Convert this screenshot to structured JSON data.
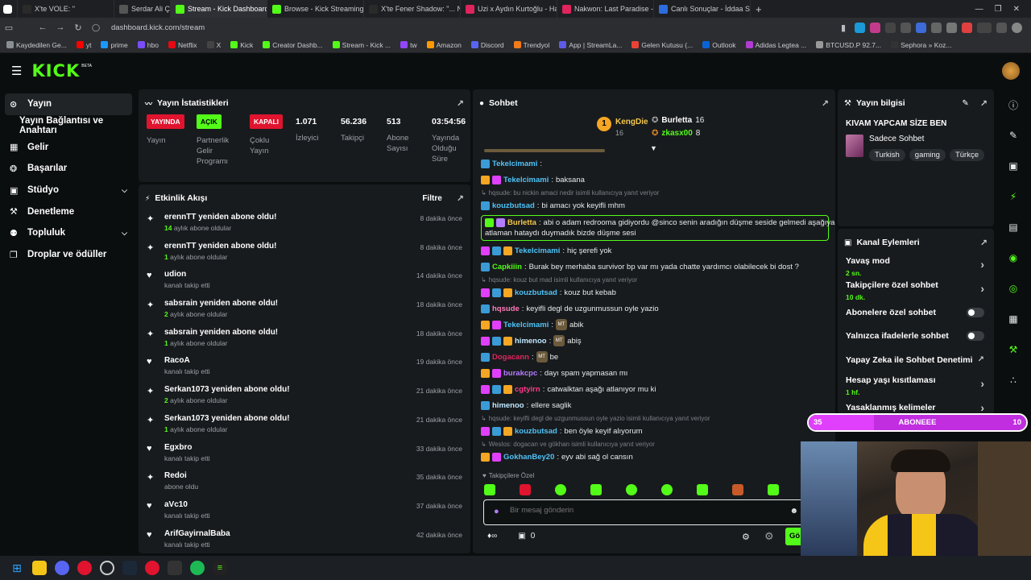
{
  "browser": {
    "tabs": [
      {
        "label": "X'te VOLE: \"",
        "color": "#2a2a2a"
      },
      {
        "label": "Serdar Ali Ç",
        "color": "#555"
      },
      {
        "label": "Stream - Kick Dashboard",
        "color": "#53fc18",
        "active": true
      },
      {
        "label": "Browse - Kick Streaming",
        "color": "#53fc18"
      },
      {
        "label": "X'te Fener Shadow: \"... N",
        "color": "#2a2a2a"
      },
      {
        "label": "Uzi x Aydın Kurtoğlu - Hay",
        "color": "#e0245e"
      },
      {
        "label": "Nakwon: Last Paradise - Of",
        "color": "#e0245e"
      },
      {
        "label": "Canlı Sonuçlar - İddaa Son",
        "color": "#2d6cdf"
      }
    ],
    "new_tab": "+",
    "url": "dashboard.kick.com/stream",
    "bookmarks": [
      {
        "label": "Kaydedilen Ge...",
        "color": "#8a8f94"
      },
      {
        "label": "yt",
        "color": "#ff0000"
      },
      {
        "label": "prime",
        "color": "#1a98ff"
      },
      {
        "label": "hbo",
        "color": "#7a4dff"
      },
      {
        "label": "Netflix",
        "color": "#e50914"
      },
      {
        "label": "X",
        "color": "#444"
      },
      {
        "label": "Kick",
        "color": "#53fc18"
      },
      {
        "label": "Creator Dashb...",
        "color": "#53fc18"
      },
      {
        "label": "Stream - Kick ...",
        "color": "#53fc18"
      },
      {
        "label": "tw",
        "color": "#9146ff"
      },
      {
        "label": "Amazon",
        "color": "#ff9900"
      },
      {
        "label": "Discord",
        "color": "#5865f2"
      },
      {
        "label": "Trendyol",
        "color": "#f27a1a"
      },
      {
        "label": "App | StreamLa...",
        "color": "#5e5ce6"
      },
      {
        "label": "Gelen Kutusu (...",
        "color": "#ea4335"
      },
      {
        "label": "Outlook",
        "color": "#0a64d6"
      },
      {
        "label": "Adidas Legtea ...",
        "color": "#b03cd0"
      },
      {
        "label": "BTCUSD.P 92.7...",
        "color": "#999"
      },
      {
        "label": "Sephora » Koz...",
        "color": "#333"
      }
    ]
  },
  "app": {
    "logo": "KICK",
    "beta": "BETA"
  },
  "sidebar": {
    "items": [
      {
        "label": "Yayın",
        "icon": "broadcast-icon",
        "active": true
      },
      {
        "label": "Yayın Bağlantısı ve Anahtarı",
        "sub": true
      },
      {
        "label": "Gelir",
        "icon": "revenue-icon"
      },
      {
        "label": "Başarılar",
        "icon": "trophy-icon"
      },
      {
        "label": "Stüdyo",
        "icon": "studio-icon",
        "chev": true
      },
      {
        "label": "Denetleme",
        "icon": "wrench-icon"
      },
      {
        "label": "Topluluk",
        "icon": "community-icon",
        "chev": true
      },
      {
        "label": "Droplar ve ödüller",
        "icon": "gift-icon"
      }
    ]
  },
  "stats": {
    "title": "Yayın İstatistikleri",
    "yayinda": "YAYINDA",
    "yayin_lbl": "Yayın",
    "acik": "AÇIK",
    "partner_lbl": "Partnerlik Gelir Programı",
    "kapali": "KAPALI",
    "coklu_lbl": "Çoklu Yayın",
    "viewers": "1.071",
    "viewers_lbl": "İzleyici",
    "followers": "56.236",
    "followers_lbl": "Takipçi",
    "subs": "513",
    "subs_lbl": "Abone Sayısı",
    "duration": "03:54:56",
    "duration_lbl": "Yayında Olduğu Süre"
  },
  "activity": {
    "title": "Etkinlik Akışı",
    "filter": "Filtre",
    "items": [
      {
        "type": "sub",
        "t1": "erennTT yeniden abone oldu!",
        "num": "14",
        "rest": " aylık abone oldular",
        "time": "8 dakika önce"
      },
      {
        "type": "sub",
        "t1": "erennTT yeniden abone oldu!",
        "num": "1",
        "rest": " aylık abone oldular",
        "time": "8 dakika önce"
      },
      {
        "type": "follow",
        "t1": "udion",
        "t2": "kanalı takip etti",
        "time": "14 dakika önce"
      },
      {
        "type": "sub",
        "t1": "sabsrain yeniden abone oldu!",
        "num": "2",
        "rest": " aylık abone oldular",
        "time": "18 dakika önce"
      },
      {
        "type": "sub",
        "t1": "sabsrain yeniden abone oldu!",
        "num": "1",
        "rest": " aylık abone oldular",
        "time": "18 dakika önce"
      },
      {
        "type": "follow",
        "t1": "RacoA",
        "t2": "kanalı takip etti",
        "time": "19 dakika önce"
      },
      {
        "type": "sub",
        "t1": "Serkan1073 yeniden abone oldu!",
        "num": "2",
        "rest": " aylık abone oldular",
        "time": "21 dakika önce"
      },
      {
        "type": "sub",
        "t1": "Serkan1073 yeniden abone oldu!",
        "num": "1",
        "rest": " aylık abone oldular",
        "time": "21 dakika önce"
      },
      {
        "type": "follow",
        "t1": "Egxbro",
        "t2": "kanalı takip etti",
        "time": "33 dakika önce"
      },
      {
        "type": "sub",
        "t1": "Redoi",
        "t2": "abone oldu",
        "time": "35 dakika önce"
      },
      {
        "type": "follow",
        "t1": "aVc10",
        "t2": "kanalı takip etti",
        "time": "37 dakika önce"
      },
      {
        "type": "follow",
        "t1": "ArifGayirnalBaba",
        "t2": "kanalı takip etti",
        "time": "42 dakika önce"
      }
    ]
  },
  "chat": {
    "title": "Sohbet",
    "top": [
      {
        "name": "KengDie",
        "count": "16",
        "rank": "1"
      },
      {
        "name": "Burletta",
        "count": "16"
      },
      {
        "name": "zkasx00",
        "count": "8"
      }
    ],
    "messages": [
      {
        "kind": "msg",
        "user": "Tekelcimami",
        "color": "#4fc3f7",
        "text": ""
      },
      {
        "kind": "msg",
        "user": "Tekelcimami",
        "color": "#4fc3f7",
        "text": "baksana"
      },
      {
        "kind": "reply",
        "text": "hqsude: bu nickin amaci nedir isimli kullanıcıya yanıt veriyor"
      },
      {
        "kind": "msg",
        "user": "kouzbutsad",
        "color": "#4fc3f7",
        "text": "bi amacı yok keyifli mhm"
      },
      {
        "kind": "hl",
        "user": "Burletta",
        "color": "#f5c84c",
        "text": "abi o adam redrooma gidiyordu @sinco senin aradığın düşme seside gelmedi aşağıya",
        "text2": "atlaman hataydı duymadık bizde düşme sesi"
      },
      {
        "kind": "msg",
        "user": "Tekelcimami",
        "color": "#4fc3f7",
        "text": "hiç şerefi yok"
      },
      {
        "kind": "msg",
        "user": "Capkiiin",
        "color": "#53fc18",
        "text": "Burak bey merhaba survivor bp var mı yada chatte yardımcı olabilecek bi dost ?"
      },
      {
        "kind": "reply",
        "text": "hqsude: kouz but mad isimli kullanıcıya yanıt veriyor"
      },
      {
        "kind": "msg",
        "user": "kouzbutsad",
        "color": "#4fc3f7",
        "text": "kouz but kebab"
      },
      {
        "kind": "msg",
        "user": "hqsude",
        "color": "#ff7ab8",
        "text": "keyifli degl de uzgunmussun oyle yazio"
      },
      {
        "kind": "msg",
        "user": "Tekelcimami",
        "color": "#4fc3f7",
        "text": "abik",
        "emote": "MT"
      },
      {
        "kind": "msg",
        "user": "himenoo",
        "color": "#c0e8ff",
        "text": "abiş",
        "emote": "MT"
      },
      {
        "kind": "msg",
        "user": "Dogacann",
        "color": "#e0245e",
        "text": "be",
        "emote": "MT"
      },
      {
        "kind": "msg",
        "user": "burakcpc",
        "color": "#b47cff",
        "text": "dayı spam yapmasan mı"
      },
      {
        "kind": "msg",
        "user": "cgtyirn",
        "color": "#ff3b8a",
        "text": "catwalktan aşağı atlanıyor mu ki"
      },
      {
        "kind": "msg",
        "user": "himenoo",
        "color": "#c0e8ff",
        "text": "ellere saglik"
      },
      {
        "kind": "reply",
        "text": "hqsude: keyifli degl de uzgunmussun oyle yazio isimli kullanıcıya yanıt veriyor"
      },
      {
        "kind": "msg",
        "user": "kouzbutsad",
        "color": "#4fc3f7",
        "text": "ben öyle keyif alıyorum"
      },
      {
        "kind": "reply",
        "text": "Weslos: dogacan ve gökhan      isimli kullanıcıya yanıt veriyor"
      },
      {
        "kind": "msg",
        "user": "GokhanBey20",
        "color": "#4fc3f7",
        "text": "eyv abi sağ ol cansın"
      }
    ],
    "followers_only": "Takipçilere Özel",
    "placeholder": "Bir mesaj gönderin",
    "count": "0",
    "send": "Gö"
  },
  "info": {
    "title": "Yayın bilgisi",
    "stream_title": "KIVAM YAPCAM SİZE BEN",
    "category": "Sadece Sohbet",
    "tags": [
      "Turkish",
      "gaming",
      "Türkçe"
    ]
  },
  "actions": {
    "title": "Kanal Eylemleri",
    "items": [
      {
        "label": "Yavaş mod",
        "sub": "2 sn.",
        "ctrl": "chevron"
      },
      {
        "label": "Takipçilere özel sohbet",
        "sub": "10 dk.",
        "ctrl": "chevron"
      },
      {
        "label": "Abonelere özel sohbet",
        "ctrl": "toggle"
      },
      {
        "label": "Yalnızca ifadelerle sohbet",
        "ctrl": "toggle"
      },
      {
        "label": "Yapay Zeka ile Sohbet Denetimi",
        "ctrl": "ext"
      },
      {
        "label": "Hesap yaşı kısıtlaması",
        "sub": "1 hf.",
        "ctrl": "chevron"
      },
      {
        "label": "Yasaklanmış kelimeler",
        "ctrl": "chevron"
      }
    ]
  },
  "goal": {
    "left": "35",
    "label": "ABONEEE",
    "right": "10",
    "fill": 0.3
  },
  "colors": {
    "accent": "#53fc18",
    "panel": "#181b1e",
    "bg": "#0b0e0f",
    "goal": "#e040fb"
  }
}
